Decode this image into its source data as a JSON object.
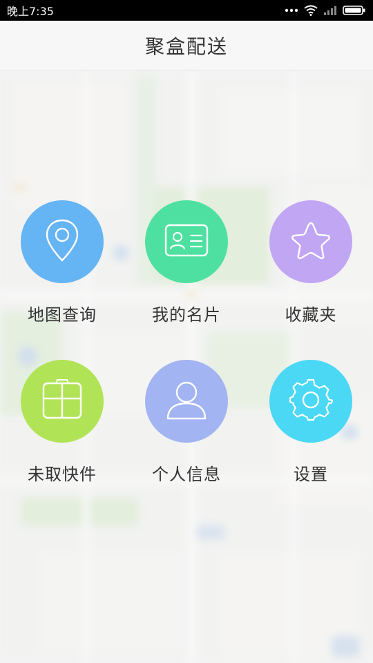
{
  "status_bar": {
    "time": "晚上7:35",
    "icons": [
      "more-dots-icon",
      "wifi-icon",
      "signal-icon",
      "battery-icon"
    ]
  },
  "header": {
    "title": "聚盒配送"
  },
  "menu": {
    "items": [
      {
        "label": "地图查询",
        "icon": "location-pin-icon",
        "color": "#65b4f4"
      },
      {
        "label": "我的名片",
        "icon": "id-card-icon",
        "color": "#4ee0a0"
      },
      {
        "label": "收藏夹",
        "icon": "star-icon",
        "color": "#c1a6f4"
      },
      {
        "label": "未取快件",
        "icon": "package-box-icon",
        "color": "#b0e456"
      },
      {
        "label": "个人信息",
        "icon": "user-icon",
        "color": "#a3b4f2"
      },
      {
        "label": "设置",
        "icon": "gear-icon",
        "color": "#4ad8f4"
      }
    ]
  }
}
